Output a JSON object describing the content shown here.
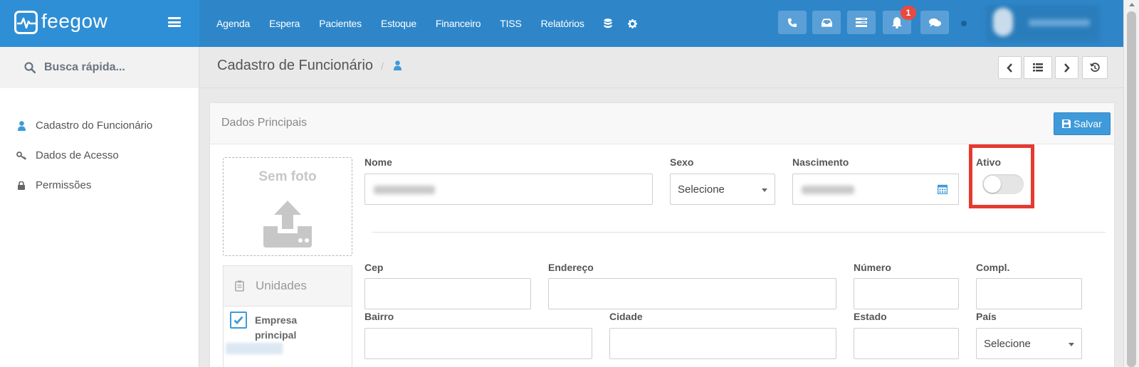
{
  "app": {
    "logo_text": "feegow"
  },
  "topnav": {
    "items": [
      "Agenda",
      "Espera",
      "Pacientes",
      "Estoque",
      "Financeiro",
      "TISS",
      "Relatórios"
    ],
    "icons": [
      "database-icon",
      "gear-icon"
    ],
    "buttons": [
      "phone-icon",
      "inbox-icon",
      "queue-icon",
      "bell-icon",
      "chat-icon"
    ],
    "notification_count": "1"
  },
  "sidebar": {
    "search_label": "Busca rápida...",
    "items": [
      {
        "label": "Cadastro do Funcionário",
        "icon": "user-icon"
      },
      {
        "label": "Dados de Acesso",
        "icon": "key-icon"
      },
      {
        "label": "Permissões",
        "icon": "lock-icon"
      }
    ]
  },
  "header": {
    "title": "Cadastro de Funcionário",
    "separator": "/"
  },
  "panel": {
    "title": "Dados Principais",
    "save_label": "Salvar",
    "photo_label": "Sem foto",
    "unidades_label": "Unidades",
    "empresa_line1": "Empresa",
    "empresa_line2": "principal",
    "empresa_checked": true
  },
  "form": {
    "nome_label": "Nome",
    "sexo_label": "Sexo",
    "sexo_value": "Selecione",
    "nascimento_label": "Nascimento",
    "ativo_label": "Ativo",
    "ativo_value": false,
    "cep_label": "Cep",
    "endereco_label": "Endereço",
    "numero_label": "Número",
    "compl_label": "Compl.",
    "bairro_label": "Bairro",
    "cidade_label": "Cidade",
    "estado_label": "Estado",
    "pais_label": "País",
    "pais_value": "Selecione"
  },
  "colors": {
    "brand": "#2e86c9",
    "save": "#3f9ad9",
    "highlight": "#e53a30",
    "badge": "#e84a3f"
  }
}
